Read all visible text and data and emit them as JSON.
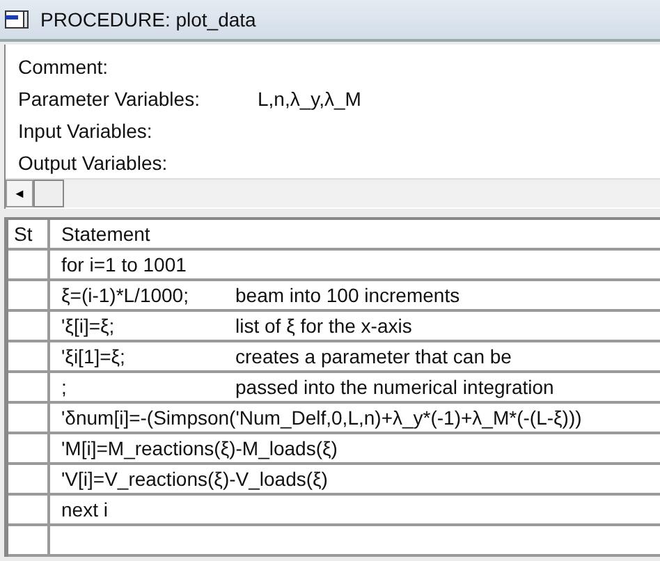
{
  "window": {
    "title": "PROCEDURE: plot_data"
  },
  "header": {
    "fields": [
      {
        "label": "Comment:"
      },
      {
        "label": "Parameter Variables:",
        "value": "L,n,λ_y,λ_M"
      },
      {
        "label": "Input Variables:"
      },
      {
        "label": "Output Variables:"
      }
    ],
    "scroll_arrow": "◄"
  },
  "table": {
    "columns": [
      "St",
      "Statement"
    ],
    "rows": [
      {
        "code": "for i=1 to 1001"
      },
      {
        "code": "ξ=(i-1)*L/1000;",
        "comment": "beam into 100 increments"
      },
      {
        "code": "'ξ[i]=ξ;",
        "comment": "list of ξ for the x-axis"
      },
      {
        "code": "'ξi[1]=ξ;",
        "comment": "creates a parameter that can be"
      },
      {
        "code": ";",
        "comment": "passed into the numerical integration"
      },
      {
        "code": "'δnum[i]=-(Simpson('Num_Delf,0,L,n)+λ_y*(-1)+λ_M*(-(L-ξ)))"
      },
      {
        "code": "'M[i]=M_reactions(ξ)-M_loads(ξ)"
      },
      {
        "code": "'V[i]=V_reactions(ξ)-V_loads(ξ)"
      },
      {
        "code": "next i"
      }
    ]
  }
}
